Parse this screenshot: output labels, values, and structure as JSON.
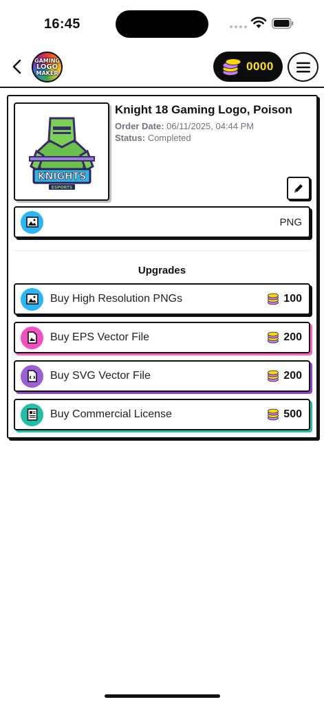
{
  "status_bar": {
    "time": "16:45"
  },
  "nav": {
    "logo_text": [
      "GAMING",
      "LOGO",
      "MAKER"
    ],
    "coins": "0000",
    "coin_color": "#ffe500"
  },
  "order": {
    "title": "Knight 18 Gaming Logo, Poison",
    "order_date_label": "Order Date:",
    "order_date": "06/11/2025, 04:44 PM",
    "status_label": "Status:",
    "status": "Completed",
    "logo_text": "KNIGHTS",
    "logo_subtext": "ESPORTS",
    "format": "PNG",
    "format_icon": "image-icon"
  },
  "upgrades": {
    "title": "Upgrades",
    "items": [
      {
        "label": "Buy High Resolution PNGs",
        "price": "100",
        "icon": "image-icon",
        "color": "#29b6f6"
      },
      {
        "label": "Buy EPS Vector File",
        "price": "200",
        "icon": "eps-file-icon",
        "color": "#f24fc0"
      },
      {
        "label": "Buy SVG Vector File",
        "price": "200",
        "icon": "svg-code-file-icon",
        "color": "#9a5fd4"
      },
      {
        "label": "Buy Commercial License",
        "price": "500",
        "icon": "license-document-icon",
        "color": "#1fbfa7"
      }
    ]
  }
}
